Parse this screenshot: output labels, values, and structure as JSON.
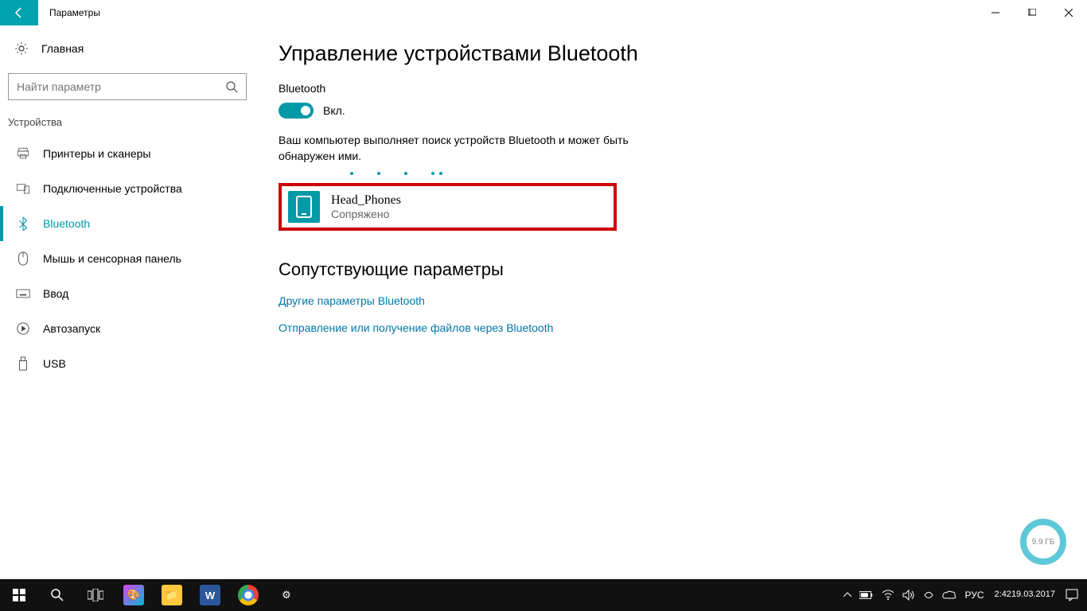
{
  "window": {
    "title": "Параметры"
  },
  "sidebar": {
    "home": "Главная",
    "search_placeholder": "Найти параметр",
    "section": "Устройства",
    "items": [
      {
        "label": "Принтеры и сканеры"
      },
      {
        "label": "Подключенные устройства"
      },
      {
        "label": "Bluetooth"
      },
      {
        "label": "Мышь и сенсорная панель"
      },
      {
        "label": "Ввод"
      },
      {
        "label": "Автозапуск"
      },
      {
        "label": "USB"
      }
    ]
  },
  "main": {
    "heading": "Управление устройствами Bluetooth",
    "bt_label": "Bluetooth",
    "toggle_state": "Вкл.",
    "search_text": "Ваш компьютер выполняет поиск устройств Bluetooth и может быть обнаружен ими.",
    "device": {
      "name": "Head_Phones",
      "status": "Сопряжено"
    },
    "related_heading": "Сопутствующие параметры",
    "link1": "Другие параметры Bluetooth",
    "link2": "Отправление или получение файлов через Bluetooth"
  },
  "badge": "9.9 ГБ",
  "taskbar": {
    "lang": "РУС",
    "time": "2:42",
    "date": "19.03.2017"
  }
}
